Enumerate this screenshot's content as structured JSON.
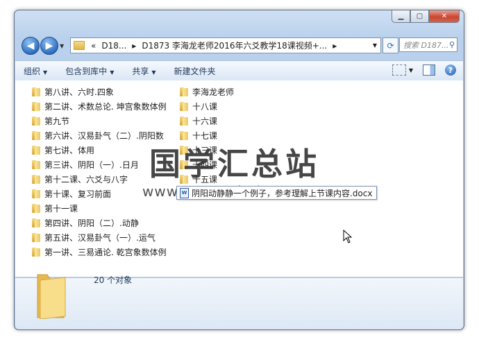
{
  "window": {
    "controls": [
      "minimize",
      "maximize",
      "close"
    ]
  },
  "nav": {
    "breadcrumb": {
      "overflow": "«",
      "segments": [
        "D18...",
        "D1873 李海龙老师2016年六爻教学18课视频+..."
      ],
      "separator": "▸"
    },
    "search_placeholder": "搜索 D187..."
  },
  "toolbar": {
    "organize": "组织",
    "include_in_library": "包含到库中",
    "share": "共享",
    "new_folder": "新建文件夹"
  },
  "folders_col1": [
    "第八讲、六时.四象",
    "第二讲、术数总论. 坤宫象数体例",
    "第九节",
    "第六讲、汉易卦气（二）.阴阳数",
    "第七讲、体用",
    "第三讲、阴阳（一）.日月",
    "第十二课、六爻与八字",
    "第十课、复习前面",
    "第十一课",
    "第四讲、阴阳（二）.动静",
    "第五讲、汉易卦气（一）.运气",
    "第一讲、三易通论. 乾宫象数体例"
  ],
  "folders_col2": [
    "李海龙老师",
    "十八课",
    "十六课",
    "十七课",
    "十三课",
    "十四课",
    "十五课"
  ],
  "drag_tooltip": "阴阳动静静一个例子，参考理解上节课内容.docx",
  "watermark": {
    "text": "国学汇总站",
    "url": "www.guoxuehuizong.com"
  },
  "status": {
    "count_text": "20 个对象"
  }
}
